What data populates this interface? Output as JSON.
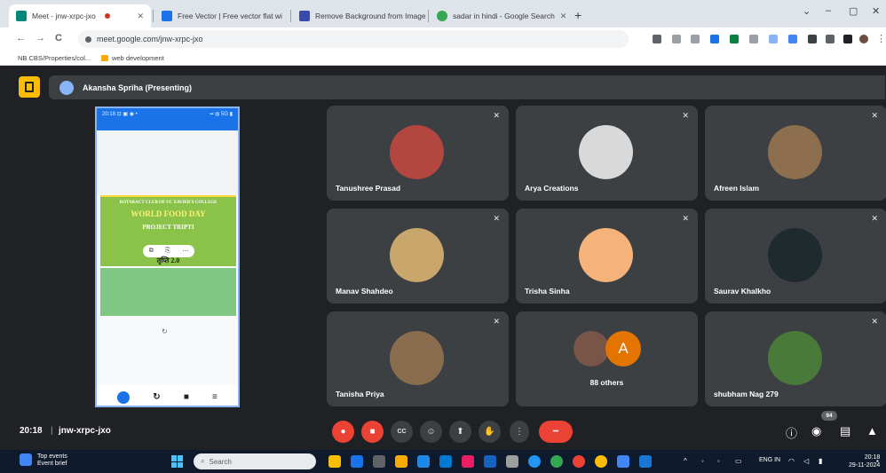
{
  "browser": {
    "tabs": [
      {
        "label": "Meet - jnw-xrpc-jxo",
        "active": true
      },
      {
        "label": "Free Vector | Free vector flat wi"
      },
      {
        "label": "Remove Background from Image"
      },
      {
        "label": "sadar in hindi - Google Search"
      }
    ],
    "new_tab": "+",
    "window_controls": {
      "dropdown": "⌄",
      "minimize": "–",
      "maximize": "▢",
      "close": "✕"
    },
    "nav": {
      "back": "←",
      "forward": "→",
      "reload": "C"
    },
    "url": "meet.google.com/jnw-xrpc-jxo",
    "bookmarks": [
      "NB  CBS/Properties/col...",
      "web development"
    ]
  },
  "meet": {
    "presenter_label": "Akansha Spriha (Presenting)",
    "screen": {
      "status_left": "20:18 ⊡ ▣ ◉ •",
      "status_right": "▪▪ ◍ 5G ▮",
      "poster_line1": "ROTARACT CLUB OF ST. XAVIER'S COLLEGE",
      "poster_line2": "WORLD FOOD DAY",
      "poster_line3": "PROJECT TRIPTI",
      "poster_line4": "तृप्ति 2.0",
      "poster_toolbar": [
        "⧉",
        "⎘",
        "⋯"
      ],
      "rotate_icon": "↻",
      "nav_buttons": [
        "",
        "↻",
        "■",
        "≡"
      ]
    },
    "participants": [
      {
        "name": "Tanushree Prasad",
        "avatar_color": "#b3473f"
      },
      {
        "name": "Arya Creations",
        "avatar_color": "#d9d9d9"
      },
      {
        "name": "Afreen Islam",
        "avatar_color": "#8d6e4f"
      },
      {
        "name": "Manav Shahdeo",
        "avatar_color": "#c9a66b"
      },
      {
        "name": "Trisha Sinha",
        "avatar_color": "#f6b27b"
      },
      {
        "name": "Saurav Khalkho",
        "avatar_color": "#1f2a2e"
      },
      {
        "name": "Tanisha Priya",
        "avatar_color": "#8a6d4e"
      },
      {
        "name": "88 others",
        "initial": "A",
        "avatar_color": "#e37400"
      },
      {
        "name": "shubham Nag 279",
        "avatar_color": "#4a7a3a"
      }
    ],
    "mic_off_icon": "🔇",
    "bottom_bar": {
      "time": "20:18",
      "separator": "|",
      "meeting_code": "jnw-xrpc-jxo",
      "controls": [
        "🎤",
        "📷",
        "CC",
        "☺",
        "⬆",
        "✋",
        "⋮",
        "☎"
      ],
      "right_icons": [
        "ⓘ",
        "👥",
        "💬",
        "⚙"
      ],
      "participant_badge": "94"
    }
  },
  "taskbar": {
    "weather_title": "Top events",
    "weather_sub": "Event brief",
    "search_placeholder": "Search",
    "tray_text": "ENG IN",
    "time": "20:18",
    "date": "29-11-2024"
  },
  "colors": {
    "accent": "#8ab4f8",
    "tile_bg": "#3c4043",
    "meet_bg": "#202124",
    "hangup": "#ea4335",
    "present": "#fbbc04"
  }
}
